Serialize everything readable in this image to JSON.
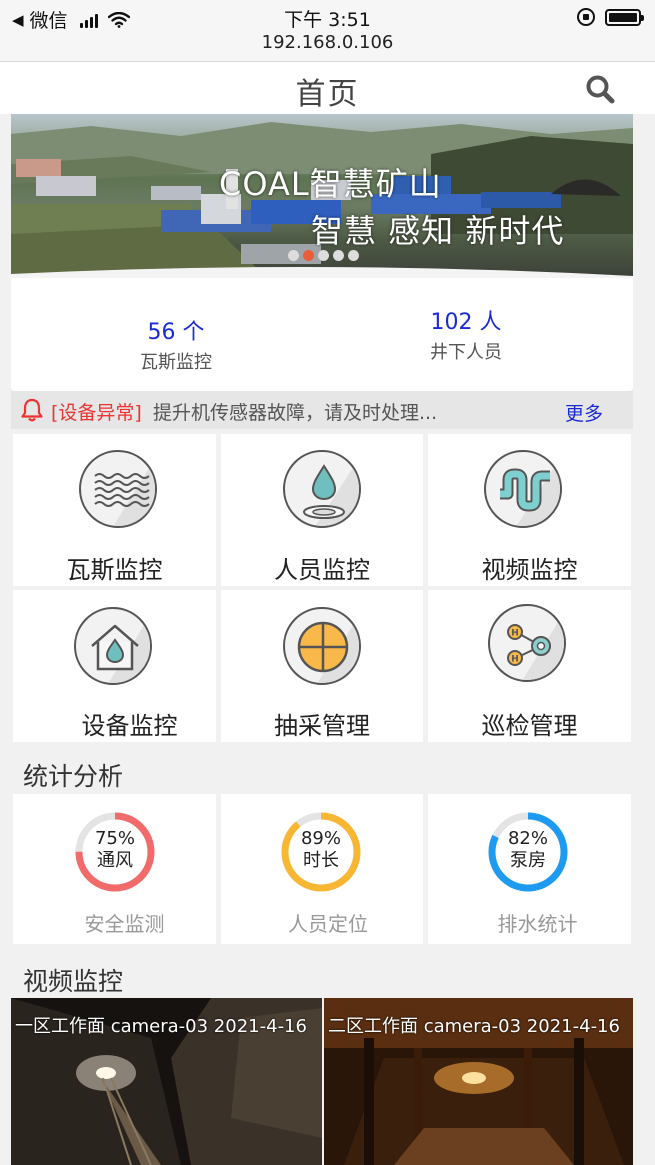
{
  "status_bar": {
    "back_app": "微信",
    "time": "下午 3:51",
    "url": "192.168.0.106"
  },
  "nav": {
    "title": "首页",
    "search_icon": "search-icon"
  },
  "banner": {
    "title": "COAL智慧矿山",
    "subtitle": "智慧 感知 新时代",
    "slide_count": 5,
    "active_slide": 2
  },
  "stats": [
    {
      "value": "56 个",
      "label": "瓦斯监控"
    },
    {
      "value": "102 人",
      "label": "井下人员"
    }
  ],
  "notice": {
    "tag": "[设备异常]",
    "text": "提升机传感器故障，请及时处理...",
    "more": "更多"
  },
  "menu": [
    {
      "label": "瓦斯监控",
      "icon": "gas-waves-icon"
    },
    {
      "label": "人员监控",
      "icon": "water-drop-icon"
    },
    {
      "label": "视频监控",
      "icon": "pipe-icon"
    },
    {
      "label": "设备监控",
      "icon": "house-drop-icon"
    },
    {
      "label": "抽采管理",
      "icon": "crosshair-circle-icon"
    },
    {
      "label": "巡检管理",
      "icon": "molecule-icon"
    }
  ],
  "analysis": {
    "title": "统计分析",
    "items": [
      {
        "percent": "75%",
        "name": "通风",
        "label": "安全监测",
        "value": 0.75,
        "color": "#f26b6b"
      },
      {
        "percent": "89%",
        "name": "时长",
        "label": "人员定位",
        "value": 0.89,
        "color": "#f7b733"
      },
      {
        "percent": "82%",
        "name": "泵房",
        "label": "排水统计",
        "value": 0.82,
        "color": "#1e9bf0"
      }
    ]
  },
  "video_section": {
    "title": "视频监控",
    "feeds": [
      {
        "label": "一区工作面 camera-03 2021-4-16"
      },
      {
        "label": "二区工作面 camera-03 2021-4-16"
      }
    ]
  }
}
